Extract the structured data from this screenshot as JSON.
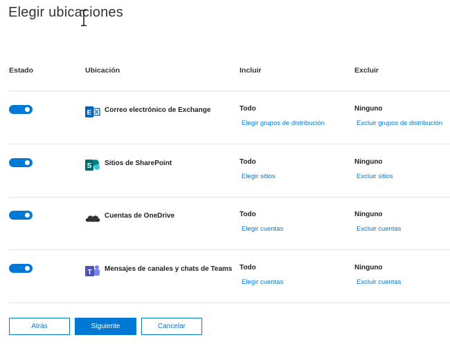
{
  "page": {
    "title": "Elegir ubicaciones"
  },
  "columns": {
    "estado": "Estado",
    "ubicacion": "Ubicación",
    "incluir": "Incluir",
    "excluir": "Excluir"
  },
  "rows": [
    {
      "name": "Correo electrónico de Exchange",
      "icon": "exchange-icon",
      "enabled": true,
      "include_value": "Todo",
      "include_link": "Elegir grupos de distribución",
      "exclude_value": "Ninguno",
      "exclude_link": "Excluir grupos de distribución"
    },
    {
      "name": "Sitios de SharePoint",
      "icon": "sharepoint-icon",
      "enabled": true,
      "include_value": "Todo",
      "include_link": "Elegir sitios",
      "exclude_value": "Ninguno",
      "exclude_link": "Excluir sitios"
    },
    {
      "name": "Cuentas de OneDrive",
      "icon": "onedrive-icon",
      "enabled": true,
      "include_value": "Todo",
      "include_link": "Elegir cuentas",
      "exclude_value": "Ninguno",
      "exclude_link": "Excluir cuentas"
    },
    {
      "name": "Mensajes de canales y chats de Teams",
      "icon": "teams-icon",
      "enabled": true,
      "include_value": "Todo",
      "include_link": "Elegir cuentas",
      "exclude_value": "Ninguno",
      "exclude_link": "Excluir cuentas"
    }
  ],
  "buttons": {
    "back": "Atrás",
    "next": "Siguiente",
    "cancel": "Cancelar"
  },
  "colors": {
    "accent": "#0078d4",
    "exchange": "#0364b8",
    "sharepoint": "#038387",
    "onedrive": "#333333",
    "teams": "#4b53bc"
  }
}
